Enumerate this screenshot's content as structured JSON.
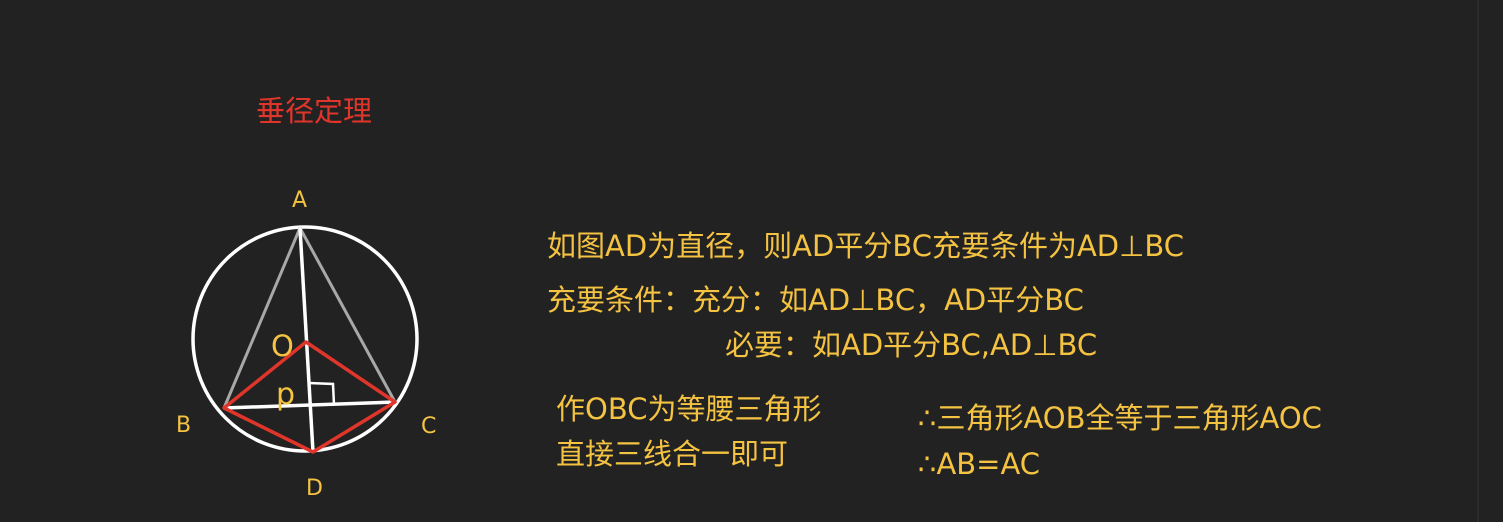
{
  "title": "垂径定理",
  "colors": {
    "background": "#222222",
    "title": "#e0352b",
    "text": "#f5c342",
    "circle": "#ffffff",
    "chord_gray": "#a8a8a8",
    "rhombus": "#e0352b"
  },
  "diagram": {
    "points": {
      "A": "A",
      "B": "B",
      "C": "C",
      "D": "D",
      "O": "O",
      "P": "p"
    }
  },
  "statements": {
    "line1": "如图AD为直径，则AD平分BC充要条件为AD⊥BC",
    "line2": "充要条件：充分：如AD⊥BC，AD平分BC",
    "line3": "必要：如AD平分BC,AD⊥BC",
    "line4": "作OBC为等腰三角形",
    "line5": "直接三线合一即可",
    "line6": "∴三角形AOB全等于三角形AOC",
    "line7": "∴AB=AC"
  }
}
